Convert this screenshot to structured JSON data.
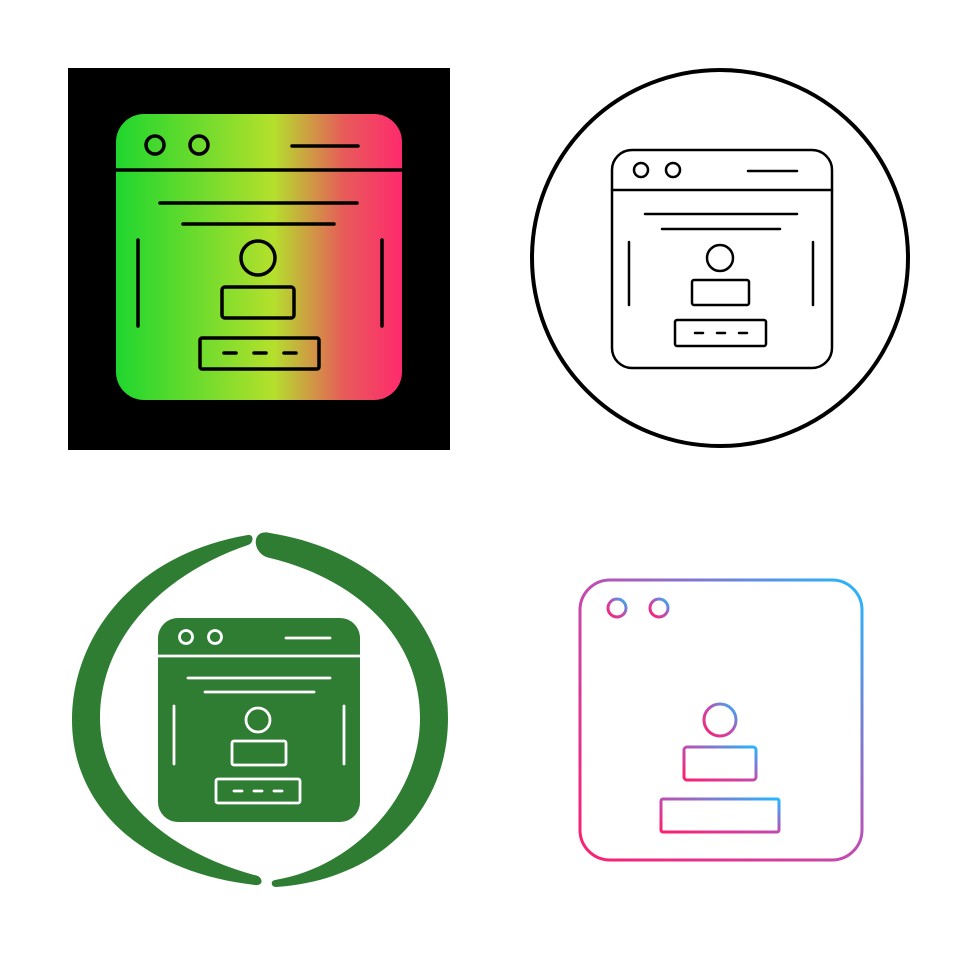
{
  "icons": [
    {
      "name": "gradient-square-variant",
      "style": "glyph-gradient",
      "background": "#000000",
      "gradient": [
        "#22d62b",
        "#c8e02a",
        "#ff2d6a"
      ]
    },
    {
      "name": "outline-circle-variant",
      "style": "outline",
      "stroke": "#000000"
    },
    {
      "name": "green-ring-variant",
      "style": "glyph-solid",
      "fill": "#2e7d32"
    },
    {
      "name": "gradient-outline-variant",
      "style": "outline-gradient",
      "gradient": [
        "#ff1e78",
        "#2bb5ff"
      ]
    }
  ],
  "subject": "browser-window-with-user-profile-login-icon"
}
